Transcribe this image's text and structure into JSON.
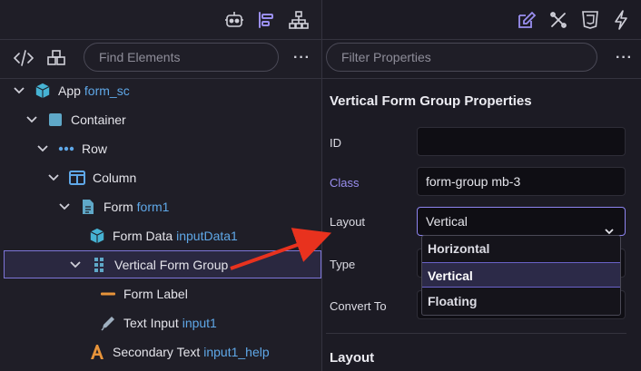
{
  "left_panel": {
    "toolbar_icons": [
      "robot-icon",
      "align-left-icon",
      "sitemap-icon"
    ],
    "search": {
      "placeholder": "Find Elements",
      "more": "···"
    },
    "tree": [
      {
        "label": "App",
        "id": "form_sc",
        "icon": "cube-icon",
        "expanded": true
      },
      {
        "label": "Container",
        "id": "",
        "icon": "square-icon",
        "expanded": true
      },
      {
        "label": "Row",
        "id": "",
        "icon": "dots-icon",
        "expanded": true
      },
      {
        "label": "Column",
        "id": "",
        "icon": "columns-icon",
        "expanded": true
      },
      {
        "label": "Form",
        "id": "form1",
        "icon": "file-icon",
        "expanded": true
      },
      {
        "label": "Form Data",
        "id": "inputData1",
        "icon": "cube-icon",
        "expanded": false
      },
      {
        "label": "Vertical Form Group",
        "id": "",
        "icon": "grip-icon",
        "expanded": true,
        "selected": true
      },
      {
        "label": "Form Label",
        "id": "",
        "icon": "dash-icon",
        "expanded": false
      },
      {
        "label": "Text Input",
        "id": "input1",
        "icon": "pencil-icon",
        "expanded": false
      },
      {
        "label": "Secondary Text",
        "id": "input1_help",
        "icon": "text-icon",
        "expanded": false
      }
    ]
  },
  "right_panel": {
    "toolbar_icons": [
      "edit-icon",
      "tools-icon",
      "css3-icon",
      "bolt-icon"
    ],
    "search": {
      "placeholder": "Filter Properties",
      "more": "···"
    },
    "title": "Vertical Form Group Properties",
    "fields": {
      "id": {
        "label": "ID",
        "value": ""
      },
      "class": {
        "label": "Class",
        "value": "form-group mb-3"
      },
      "layout": {
        "label": "Layout",
        "value": "Vertical"
      },
      "type": {
        "label": "Type"
      },
      "convert": {
        "label": "Convert To"
      }
    },
    "dropdown_options": [
      "Horizontal",
      "Vertical",
      "Floating"
    ],
    "dropdown_selected": "Vertical",
    "section": "Layout"
  },
  "colors": {
    "accent": "#8d84f0",
    "id_text": "#5fa8e8",
    "arrow": "#e8321e",
    "cube": "#46b3d4"
  }
}
